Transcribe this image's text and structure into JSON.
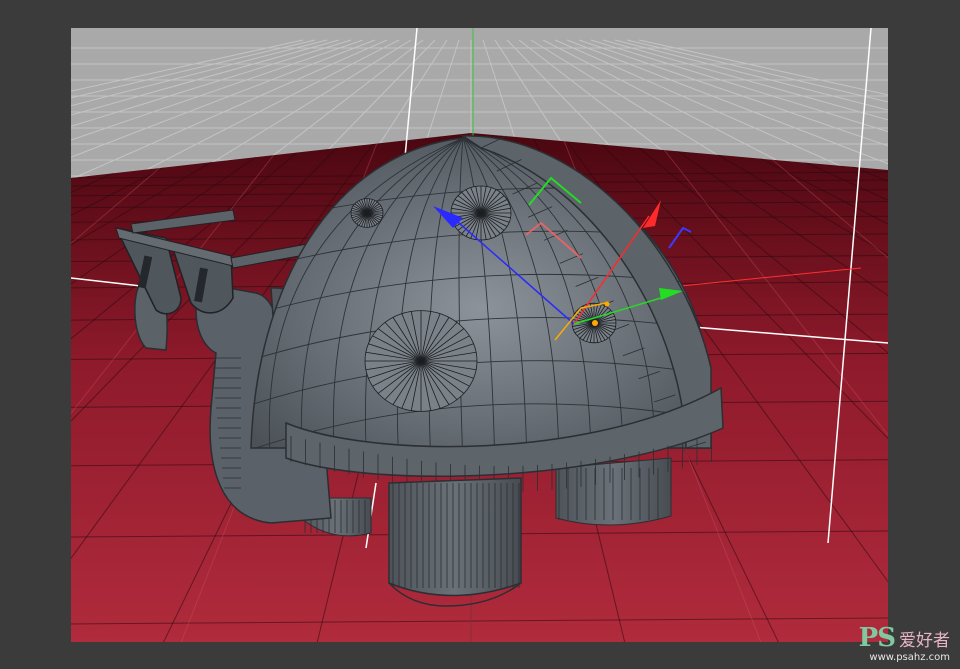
{
  "watermark": {
    "logo": "PS",
    "site_name": "爱好者",
    "url": "www.psahz.com"
  },
  "scene": {
    "background_grid_color": "#a8a8a8",
    "floor_gradient": [
      "#5c0a14",
      "#9f2234",
      "#b22b3d"
    ],
    "model_color": "#5f666d",
    "gizmo": {
      "x_axis_color": "#ff2a2a",
      "y_axis_color": "#22dd22",
      "z_axis_color": "#2a2aff",
      "center_color": "#ffaa00"
    },
    "icons": [
      "move-gizmo-icon"
    ]
  }
}
